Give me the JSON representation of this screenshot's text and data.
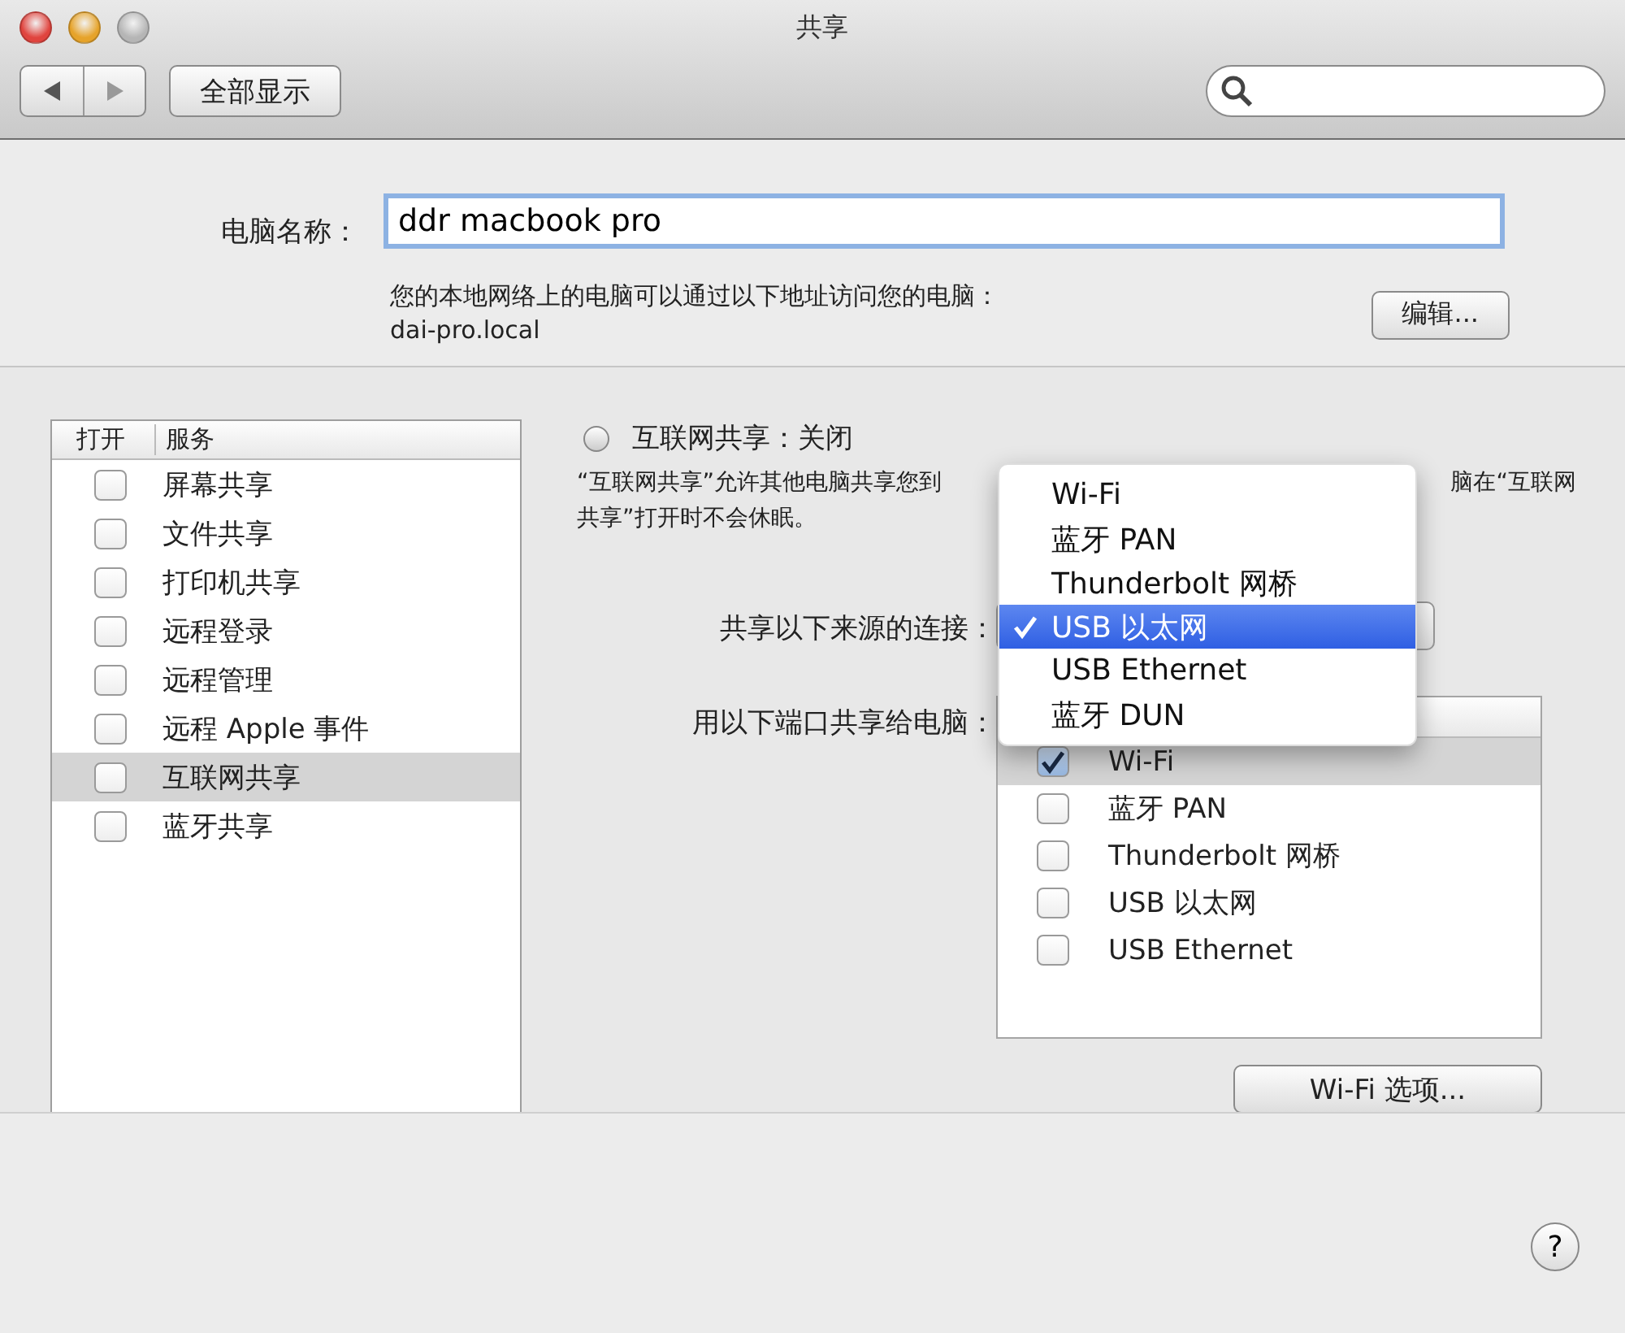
{
  "window": {
    "title": "共享"
  },
  "toolbar": {
    "show_all": "全部显示"
  },
  "computer_name": {
    "label": "电脑名称：",
    "value": "ddr macbook pro",
    "hint": "您的本地网络上的电脑可以通过以下地址访问您的电脑：",
    "address": "dai-pro.local",
    "edit_button": "编辑..."
  },
  "services": {
    "columns": [
      "打开",
      "服务"
    ],
    "rows": [
      {
        "name": "屏幕共享",
        "checked": false,
        "selected": false
      },
      {
        "name": "文件共享",
        "checked": false,
        "selected": false
      },
      {
        "name": "打印机共享",
        "checked": false,
        "selected": false
      },
      {
        "name": "远程登录",
        "checked": false,
        "selected": false
      },
      {
        "name": "远程管理",
        "checked": false,
        "selected": false
      },
      {
        "name": "远程 Apple 事件",
        "checked": false,
        "selected": false
      },
      {
        "name": "互联网共享",
        "checked": false,
        "selected": true
      },
      {
        "name": "蓝牙共享",
        "checked": false,
        "selected": false
      }
    ]
  },
  "detail": {
    "status": "互联网共享：关闭",
    "on": false,
    "description_left": "“互联网共享”允许其他电脑共享您到",
    "description_right": "脑在“互联网",
    "description_line2": "共享”打开时不会休眠。"
  },
  "source": {
    "label": "共享以下来源的连接："
  },
  "ports": {
    "label": "用以下端口共享给电脑：",
    "items": [
      {
        "name": "Wi-Fi",
        "checked": true,
        "selected": true
      },
      {
        "name": "蓝牙 PAN",
        "checked": false,
        "selected": false
      },
      {
        "name": "Thunderbolt 网桥",
        "checked": false,
        "selected": false
      },
      {
        "name": "USB 以太网",
        "checked": false,
        "selected": false
      },
      {
        "name": "USB Ethernet",
        "checked": false,
        "selected": false
      }
    ]
  },
  "wifi_options_button": "Wi-Fi 选项...",
  "menu": {
    "items": [
      {
        "label": "Wi-Fi",
        "selected": false
      },
      {
        "label": "蓝牙 PAN",
        "selected": false
      },
      {
        "label": "Thunderbolt 网桥",
        "selected": false
      },
      {
        "label": "USB 以太网",
        "selected": true
      },
      {
        "label": "USB Ethernet",
        "selected": false
      },
      {
        "label": "蓝牙 DUN",
        "selected": false
      }
    ]
  },
  "help_button": "?"
}
